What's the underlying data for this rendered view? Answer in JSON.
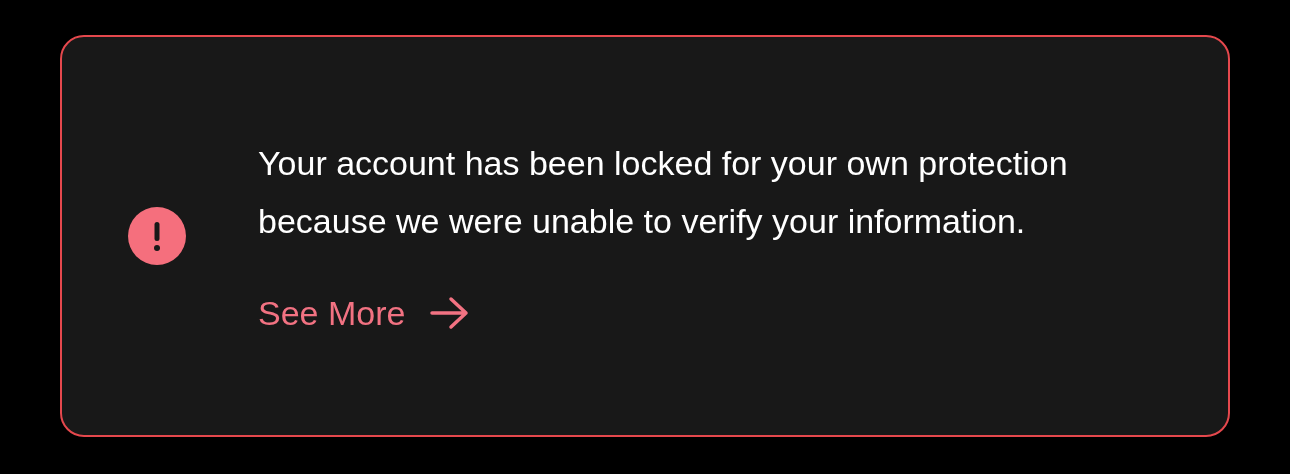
{
  "alert": {
    "message": "Your account has been locked for your own protection because we were unable to verify your information.",
    "link": "See More"
  }
}
